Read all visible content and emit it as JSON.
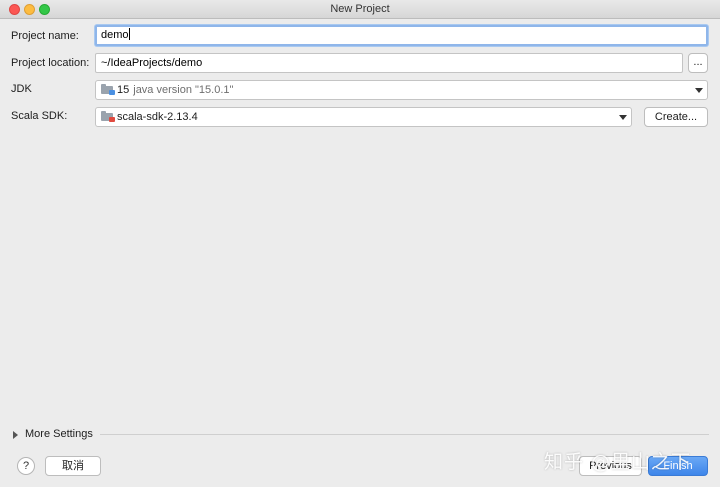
{
  "window": {
    "title": "New Project"
  },
  "form": {
    "project_name_label": "Project name:",
    "project_name_value": "demo",
    "project_location_label": "Project location:",
    "project_location_value": "~/IdeaProjects/demo",
    "browse_label": "...",
    "jdk_label": "JDK",
    "jdk_name": "15",
    "jdk_version": "java version \"15.0.1\"",
    "scala_sdk_label": "Scala SDK:",
    "scala_sdk_value": "scala-sdk-2.13.4",
    "create_label": "Create..."
  },
  "more_settings": {
    "label": "More Settings"
  },
  "footer": {
    "help_label": "?",
    "cancel_label": "取消",
    "previous_label": "Previous",
    "finish_label": "Finish"
  },
  "watermark": {
    "text": "知乎 @里山之下"
  },
  "colors": {
    "accent": "#3e86ea",
    "focus_ring": "#8fb6ea",
    "jdk_badge": "#4a90e2",
    "scala_badge": "#e04a3f"
  },
  "icons": {
    "jdk": "folder-icon",
    "scala_sdk": "folder-icon",
    "more_settings": "triangle-right-icon"
  }
}
